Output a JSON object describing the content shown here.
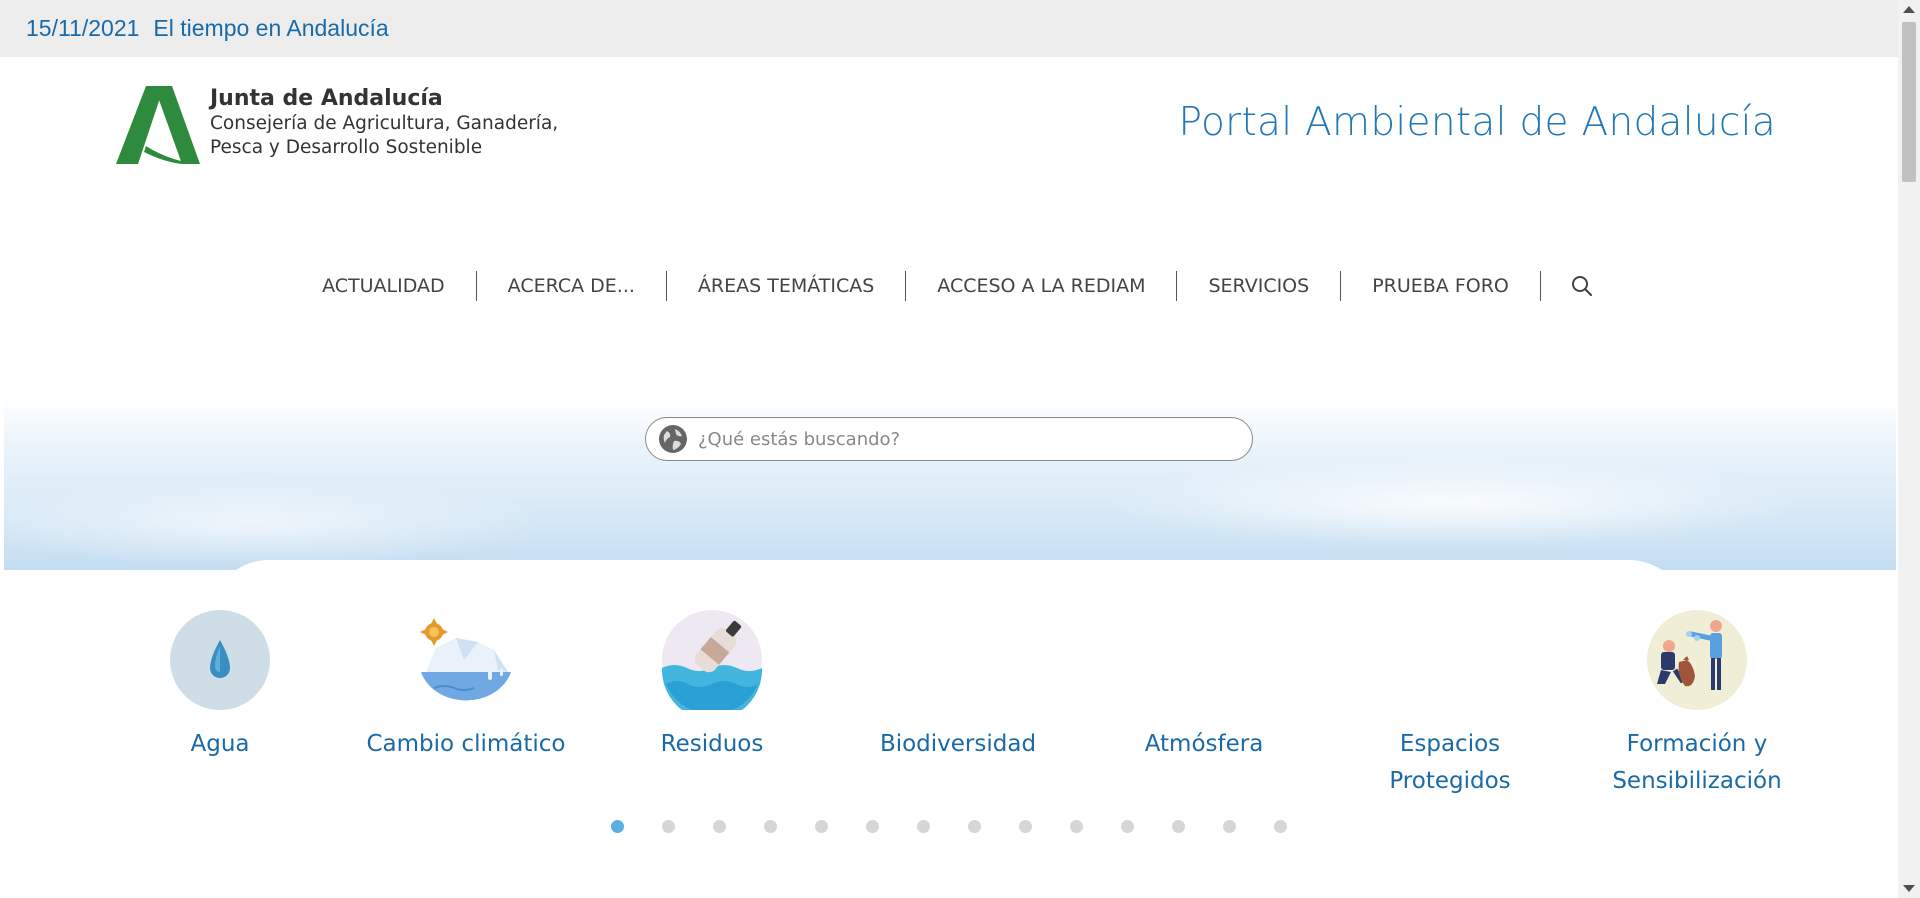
{
  "topbar": {
    "date": "15/11/2021",
    "weather_link": "El tiempo en Andalucía"
  },
  "logo": {
    "line1": "Junta de Andalucía",
    "line2": "Consejería de Agricultura, Ganadería,",
    "line3": "Pesca y Desarrollo Sostenible"
  },
  "portal_title": "Portal Ambiental de Andalucía",
  "nav": {
    "items": [
      "ACTUALIDAD",
      "ACERCA DE...",
      "ÁREAS TEMÁTICAS",
      "ACCESO A LA REDIAM",
      "SERVICIOS",
      "PRUEBA FORO"
    ],
    "search_icon": "search-icon"
  },
  "search": {
    "placeholder": "¿Qué estás buscando?",
    "icon": "globe-icon"
  },
  "categories": [
    {
      "label": "Agua",
      "icon": "water-drop-icon"
    },
    {
      "label": "Cambio climático",
      "icon": "melting-ice-icon"
    },
    {
      "label": "Residuos",
      "icon": "bottle-waste-icon"
    },
    {
      "label": "Biodiversidad",
      "icon": ""
    },
    {
      "label": "Atmósfera",
      "icon": ""
    },
    {
      "label": "Espacios Protegidos",
      "icon": ""
    },
    {
      "label": "Formación y Sensibilización",
      "icon": "people-education-icon"
    }
  ],
  "carousel": {
    "total": 14,
    "active": 1
  },
  "colors": {
    "accent": "#1a6aa8",
    "logo_green": "#2e8b3e",
    "active_dot": "#5aaee0"
  }
}
